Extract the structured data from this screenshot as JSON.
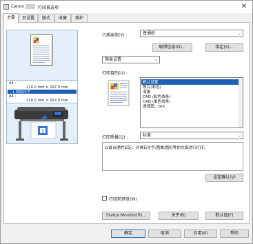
{
  "window": {
    "brand": "Canon",
    "title": "打印首选项",
    "close_glyph": "✕"
  },
  "tabs": [
    {
      "label": "主要",
      "active": true
    },
    {
      "label": "页设置",
      "active": false
    },
    {
      "label": "版式",
      "active": false
    },
    {
      "label": "收藏",
      "active": false
    },
    {
      "label": "维护",
      "active": false
    }
  ],
  "preview": {
    "size_lines": [
      "A4 :",
      "210.0 mm × 297.0 mm",
      "↓ 实际尺寸",
      "A4 :",
      "210.0 mm × 297.0 mm"
    ]
  },
  "media": {
    "label": "介质类型(Y) :",
    "value": "普通纸",
    "get_info_button": "取得信息(O)...",
    "specify_button": "指定(S)..."
  },
  "mode": {
    "value": "简易设置"
  },
  "purpose": {
    "label": "打印目的(U) :",
    "items": [
      "默认设置",
      "照片(彩色)",
      "海报",
      "CAD (彩色线条)",
      "CAD (单色线条)",
      "透视图、GIS"
    ],
    "selected_index": 0
  },
  "quality": {
    "label": "打印质量(Q) :",
    "value": "标准"
  },
  "description": {
    "text": "以最合理的设定，对具有文字/图像/图形等的文章进行打印。",
    "confirm_button": "设定确认(V)"
  },
  "preview_check": {
    "label": "打印前预览(W)",
    "checked": false
  },
  "bottom": {
    "status_monitor_button": "Status Monitor(R)...",
    "about_button": "关于(B)",
    "defaults_button": "默认值(F)"
  },
  "footer": {
    "ok_button": "确定",
    "cancel_button": "取消",
    "apply_button": "应用(A)",
    "help_button": "帮助"
  },
  "colors": {
    "selection": "#1f5fb4",
    "primary_border": "#1f6fd1"
  },
  "icons": [
    "printer-app-icon",
    "close-icon",
    "dropdown-arrow-icon",
    "document-thumbnail-icon",
    "large-format-printer-icon"
  ]
}
